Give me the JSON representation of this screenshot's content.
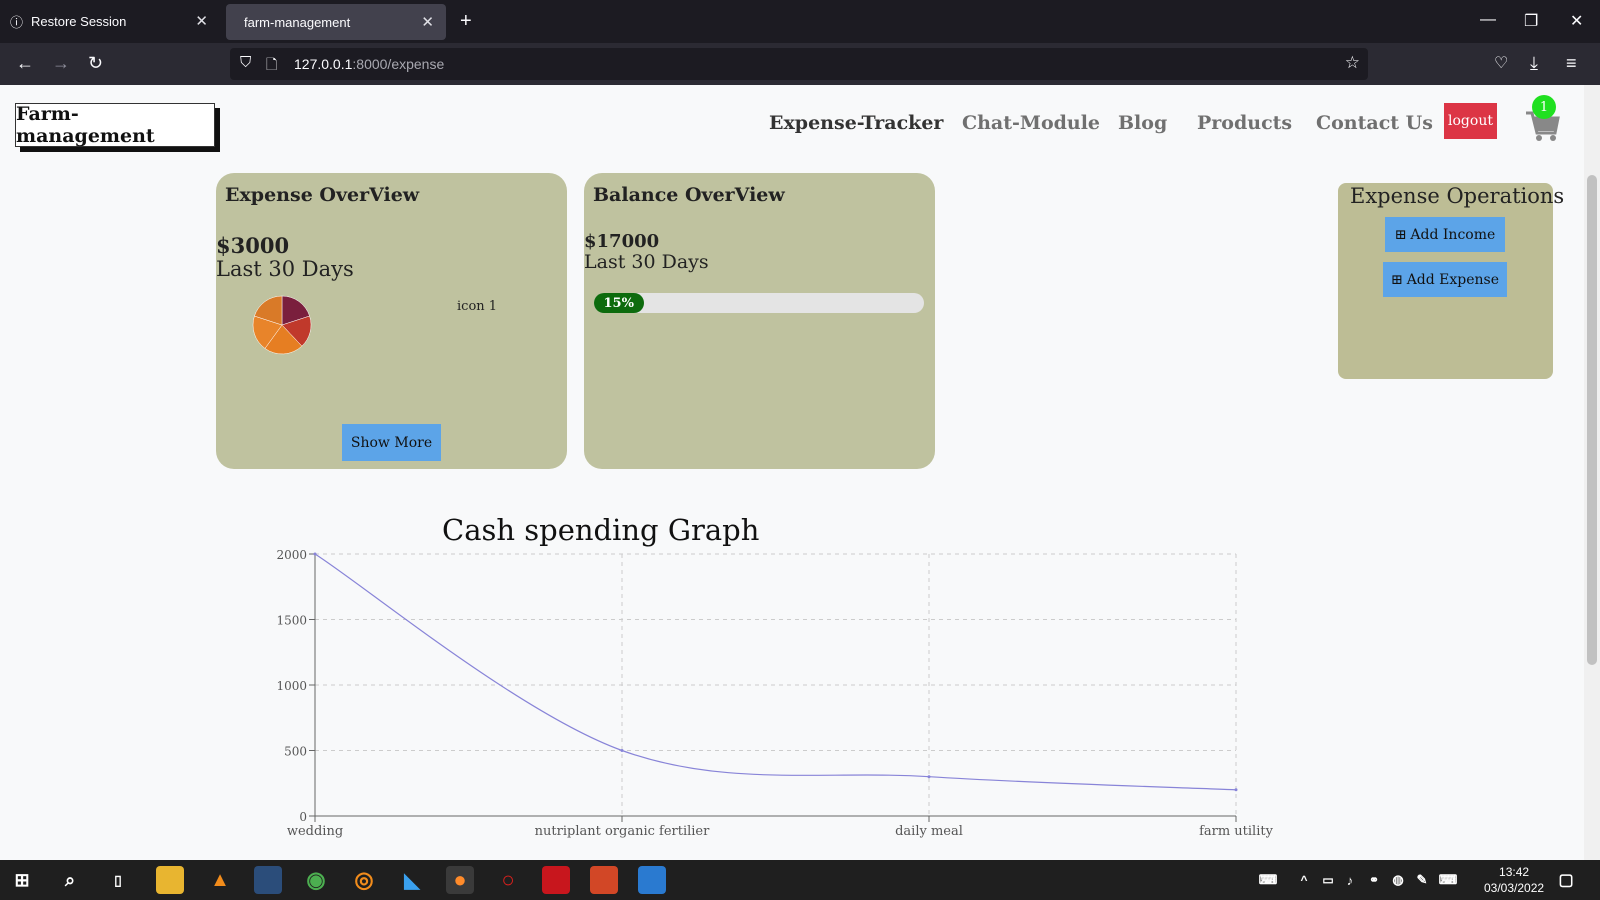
{
  "browser": {
    "tabs": [
      {
        "label": "Restore Session"
      },
      {
        "label": "farm-management"
      }
    ],
    "url_host": "127.0.0.1",
    "url_path": ":8000/expense"
  },
  "header": {
    "brand": "Farm-management",
    "nav": [
      "Expense-Tracker",
      "Chat-Module",
      "Blog",
      "Products",
      "Contact Us"
    ],
    "logout_label": "logout",
    "cart_count": "1"
  },
  "expense_card": {
    "title": "Expense OverView",
    "amount": "$3000",
    "period": "Last 30 Days",
    "icon_label": "icon 1",
    "button": "Show More",
    "pie_colors": [
      "#7a1f3d",
      "#c0392b",
      "#e67e22",
      "#e8842a",
      "#d97a28"
    ],
    "pie_values": [
      20,
      18,
      22,
      20,
      20
    ]
  },
  "balance_card": {
    "title": "Balance OverView",
    "amount": "$17000",
    "period": "Last 30 Days",
    "progress_label": "15%",
    "progress_value": 0.15
  },
  "operations": {
    "title": "Expense Operations",
    "add_income": "Add Income",
    "add_expense": "Add Expense"
  },
  "chart_data": {
    "type": "line",
    "title": "Cash spending Graph",
    "categories": [
      "wedding",
      "nutriplant organic fertilier",
      "daily meal",
      "farm utility"
    ],
    "values": [
      2000,
      500,
      300,
      200
    ],
    "ylim": [
      0,
      2000
    ],
    "yticks": [
      0,
      500,
      1000,
      1500,
      2000
    ],
    "grid": true,
    "line_color": "#8884d8"
  },
  "taskbar": {
    "time": "13:42",
    "date": "03/03/2022"
  }
}
